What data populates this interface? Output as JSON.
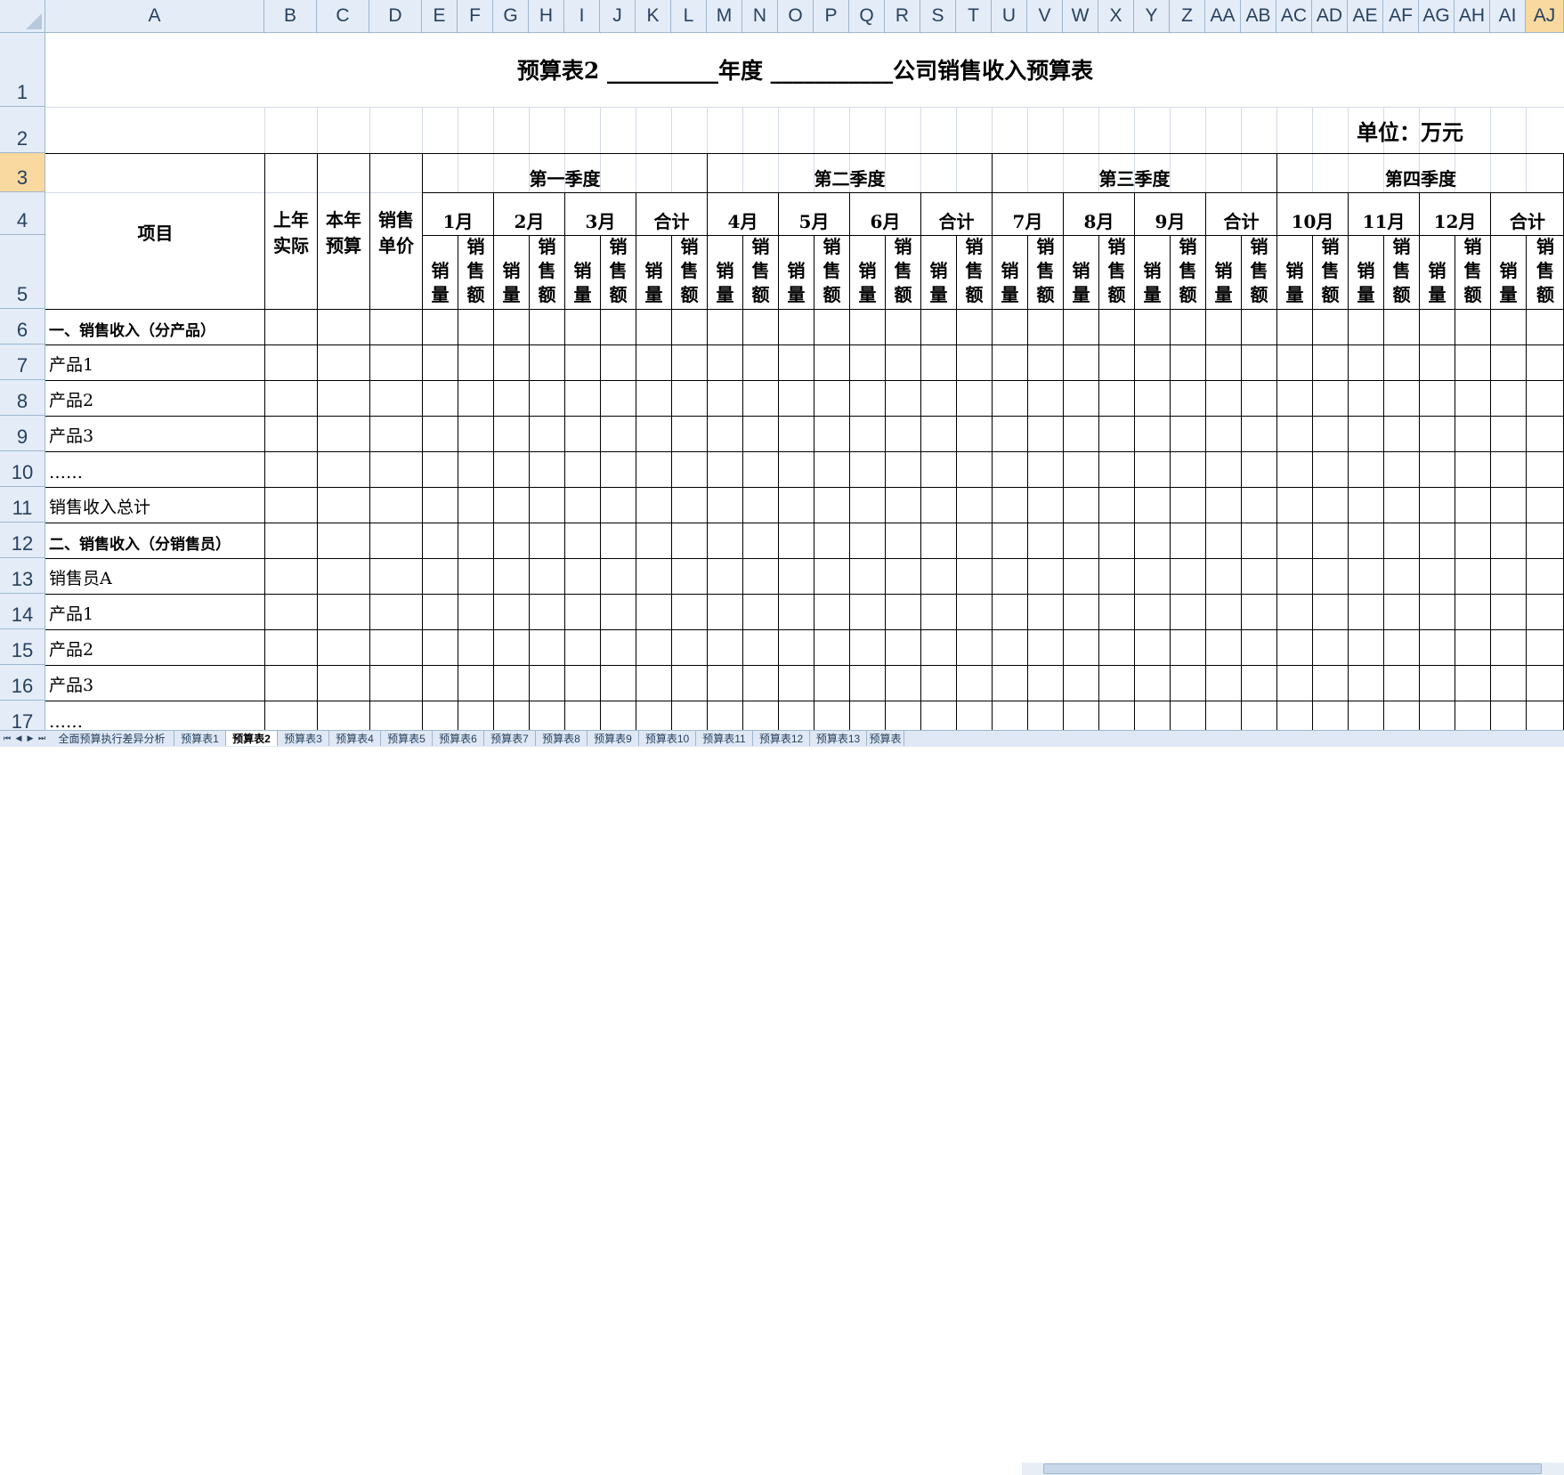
{
  "columns": [
    "A",
    "B",
    "C",
    "D",
    "E",
    "F",
    "G",
    "H",
    "I",
    "J",
    "K",
    "L",
    "M",
    "N",
    "O",
    "P",
    "Q",
    "R",
    "S",
    "T",
    "U",
    "V",
    "W",
    "X",
    "Y",
    "Z",
    "AA",
    "AB",
    "AC",
    "AD",
    "AE",
    "AF",
    "AG",
    "AH",
    "AI",
    "AJ"
  ],
  "rows": [
    "1",
    "2",
    "3",
    "4",
    "5",
    "6",
    "7",
    "8",
    "9",
    "10",
    "11",
    "12",
    "13",
    "14",
    "15",
    "16",
    "17"
  ],
  "selected_row": "3",
  "selected_column": "AJ",
  "title": "预算表2 __________年度 ___________公司销售收入预算表",
  "unit": "单位：万元",
  "header": {
    "item": "项目",
    "last_year_actual": "上年\n实际",
    "this_year_budget": "本年\n预算",
    "unit_price": "销售\n单价",
    "quarters": [
      {
        "label": "第一季度",
        "months": [
          "1月",
          "2月",
          "3月",
          "合计"
        ]
      },
      {
        "label": "第二季度",
        "months": [
          "4月",
          "5月",
          "6月",
          "合计"
        ]
      },
      {
        "label": "第三季度",
        "months": [
          "7月",
          "8月",
          "9月",
          "合计"
        ]
      },
      {
        "label": "第四季度",
        "months": [
          "10月",
          "11月",
          "12月",
          "合计"
        ]
      }
    ],
    "qty_label": "销\n量",
    "amount_label": "销\n售\n额"
  },
  "row_labels": [
    {
      "row": "6",
      "text": "一、销售收入（分产品）",
      "bold": true
    },
    {
      "row": "7",
      "text": "产品1",
      "bold": false
    },
    {
      "row": "8",
      "text": "产品2",
      "bold": false
    },
    {
      "row": "9",
      "text": "产品3",
      "bold": false
    },
    {
      "row": "10",
      "text": "……",
      "bold": false
    },
    {
      "row": "11",
      "text": "销售收入总计",
      "bold": false
    },
    {
      "row": "12",
      "text": "二、销售收入（分销售员）",
      "bold": true
    },
    {
      "row": "13",
      "text": "销售员A",
      "bold": false
    },
    {
      "row": "14",
      "text": "产品1",
      "bold": false
    },
    {
      "row": "15",
      "text": "产品2",
      "bold": false
    },
    {
      "row": "16",
      "text": "产品3",
      "bold": false
    },
    {
      "row": "17",
      "text": "……",
      "bold": false
    }
  ],
  "sheet_tabs": [
    "全面预算执行差异分析",
    "预算表1",
    "预算表2",
    "预算表3",
    "预算表4",
    "预算表5",
    "预算表6",
    "预算表7",
    "预算表8",
    "预算表9",
    "预算表10",
    "预算表11",
    "预算表12",
    "预算表13",
    "预算表"
  ],
  "active_tab": "预算表2",
  "colors": {
    "header_bg": "#e4ecf7",
    "selected_header_bg": "#f9d99f",
    "gridline": "#d4dbe6",
    "border": "#000000"
  }
}
